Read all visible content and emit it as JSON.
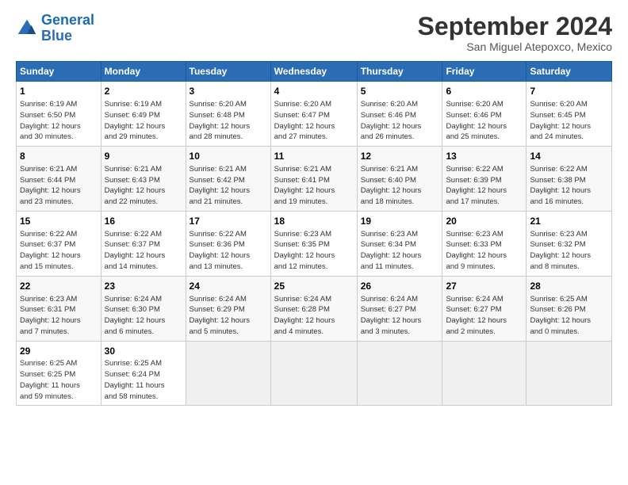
{
  "header": {
    "logo_line1": "General",
    "logo_line2": "Blue",
    "month": "September 2024",
    "location": "San Miguel Atepoxco, Mexico"
  },
  "weekdays": [
    "Sunday",
    "Monday",
    "Tuesday",
    "Wednesday",
    "Thursday",
    "Friday",
    "Saturday"
  ],
  "weeks": [
    [
      {
        "day": "1",
        "info": "Sunrise: 6:19 AM\nSunset: 6:50 PM\nDaylight: 12 hours\nand 30 minutes."
      },
      {
        "day": "2",
        "info": "Sunrise: 6:19 AM\nSunset: 6:49 PM\nDaylight: 12 hours\nand 29 minutes."
      },
      {
        "day": "3",
        "info": "Sunrise: 6:20 AM\nSunset: 6:48 PM\nDaylight: 12 hours\nand 28 minutes."
      },
      {
        "day": "4",
        "info": "Sunrise: 6:20 AM\nSunset: 6:47 PM\nDaylight: 12 hours\nand 27 minutes."
      },
      {
        "day": "5",
        "info": "Sunrise: 6:20 AM\nSunset: 6:46 PM\nDaylight: 12 hours\nand 26 minutes."
      },
      {
        "day": "6",
        "info": "Sunrise: 6:20 AM\nSunset: 6:46 PM\nDaylight: 12 hours\nand 25 minutes."
      },
      {
        "day": "7",
        "info": "Sunrise: 6:20 AM\nSunset: 6:45 PM\nDaylight: 12 hours\nand 24 minutes."
      }
    ],
    [
      {
        "day": "8",
        "info": "Sunrise: 6:21 AM\nSunset: 6:44 PM\nDaylight: 12 hours\nand 23 minutes."
      },
      {
        "day": "9",
        "info": "Sunrise: 6:21 AM\nSunset: 6:43 PM\nDaylight: 12 hours\nand 22 minutes."
      },
      {
        "day": "10",
        "info": "Sunrise: 6:21 AM\nSunset: 6:42 PM\nDaylight: 12 hours\nand 21 minutes."
      },
      {
        "day": "11",
        "info": "Sunrise: 6:21 AM\nSunset: 6:41 PM\nDaylight: 12 hours\nand 19 minutes."
      },
      {
        "day": "12",
        "info": "Sunrise: 6:21 AM\nSunset: 6:40 PM\nDaylight: 12 hours\nand 18 minutes."
      },
      {
        "day": "13",
        "info": "Sunrise: 6:22 AM\nSunset: 6:39 PM\nDaylight: 12 hours\nand 17 minutes."
      },
      {
        "day": "14",
        "info": "Sunrise: 6:22 AM\nSunset: 6:38 PM\nDaylight: 12 hours\nand 16 minutes."
      }
    ],
    [
      {
        "day": "15",
        "info": "Sunrise: 6:22 AM\nSunset: 6:37 PM\nDaylight: 12 hours\nand 15 minutes."
      },
      {
        "day": "16",
        "info": "Sunrise: 6:22 AM\nSunset: 6:37 PM\nDaylight: 12 hours\nand 14 minutes."
      },
      {
        "day": "17",
        "info": "Sunrise: 6:22 AM\nSunset: 6:36 PM\nDaylight: 12 hours\nand 13 minutes."
      },
      {
        "day": "18",
        "info": "Sunrise: 6:23 AM\nSunset: 6:35 PM\nDaylight: 12 hours\nand 12 minutes."
      },
      {
        "day": "19",
        "info": "Sunrise: 6:23 AM\nSunset: 6:34 PM\nDaylight: 12 hours\nand 11 minutes."
      },
      {
        "day": "20",
        "info": "Sunrise: 6:23 AM\nSunset: 6:33 PM\nDaylight: 12 hours\nand 9 minutes."
      },
      {
        "day": "21",
        "info": "Sunrise: 6:23 AM\nSunset: 6:32 PM\nDaylight: 12 hours\nand 8 minutes."
      }
    ],
    [
      {
        "day": "22",
        "info": "Sunrise: 6:23 AM\nSunset: 6:31 PM\nDaylight: 12 hours\nand 7 minutes."
      },
      {
        "day": "23",
        "info": "Sunrise: 6:24 AM\nSunset: 6:30 PM\nDaylight: 12 hours\nand 6 minutes."
      },
      {
        "day": "24",
        "info": "Sunrise: 6:24 AM\nSunset: 6:29 PM\nDaylight: 12 hours\nand 5 minutes."
      },
      {
        "day": "25",
        "info": "Sunrise: 6:24 AM\nSunset: 6:28 PM\nDaylight: 12 hours\nand 4 minutes."
      },
      {
        "day": "26",
        "info": "Sunrise: 6:24 AM\nSunset: 6:27 PM\nDaylight: 12 hours\nand 3 minutes."
      },
      {
        "day": "27",
        "info": "Sunrise: 6:24 AM\nSunset: 6:27 PM\nDaylight: 12 hours\nand 2 minutes."
      },
      {
        "day": "28",
        "info": "Sunrise: 6:25 AM\nSunset: 6:26 PM\nDaylight: 12 hours\nand 0 minutes."
      }
    ],
    [
      {
        "day": "29",
        "info": "Sunrise: 6:25 AM\nSunset: 6:25 PM\nDaylight: 11 hours\nand 59 minutes."
      },
      {
        "day": "30",
        "info": "Sunrise: 6:25 AM\nSunset: 6:24 PM\nDaylight: 11 hours\nand 58 minutes."
      },
      {
        "day": "",
        "info": ""
      },
      {
        "day": "",
        "info": ""
      },
      {
        "day": "",
        "info": ""
      },
      {
        "day": "",
        "info": ""
      },
      {
        "day": "",
        "info": ""
      }
    ]
  ]
}
